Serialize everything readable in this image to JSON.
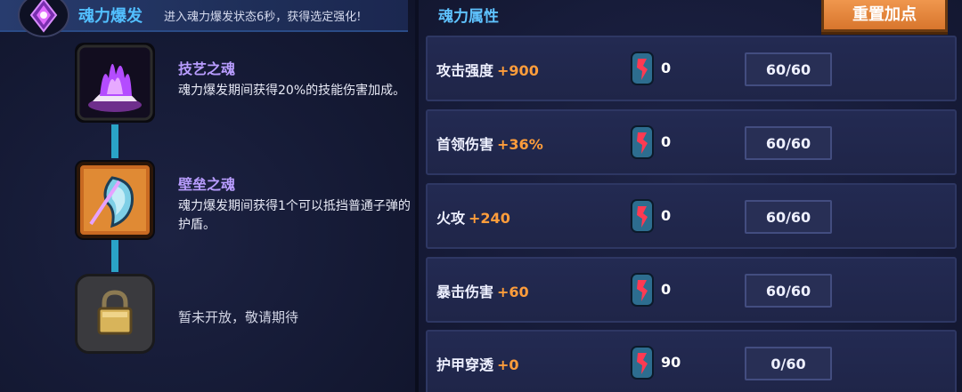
{
  "header": {
    "title": "魂力爆发",
    "desc": "进入魂力爆发状态6秒，获得选定强化!"
  },
  "right": {
    "title": "魂力属性",
    "reset_label": "重置加点"
  },
  "skills": [
    {
      "name": "技艺之魂",
      "desc": "魂力爆发期间获得20%的技能伤害加成。"
    },
    {
      "name": "壁垒之魂",
      "desc": "魂力爆发期间获得1个可以抵挡普通子弹的护盾。"
    },
    {
      "locked_text": "暂未开放，敬请期待"
    }
  ],
  "attributes": [
    {
      "label": "攻击强度",
      "bonus": "+900",
      "gems": "0",
      "level": "60/60"
    },
    {
      "label": "首领伤害",
      "bonus": "+36%",
      "gems": "0",
      "level": "60/60"
    },
    {
      "label": "火攻",
      "bonus": "+240",
      "gems": "0",
      "level": "60/60"
    },
    {
      "label": "暴击伤害",
      "bonus": "+60",
      "gems": "0",
      "level": "60/60"
    },
    {
      "label": "护甲穿透",
      "bonus": "+0",
      "gems": "90",
      "level": "0/60"
    }
  ],
  "colors": {
    "accent_blue": "#52bfff",
    "bonus_orange": "#ff9d3b",
    "skill_name_purple": "#b99dff",
    "reset_orange": "#e48a3f"
  }
}
